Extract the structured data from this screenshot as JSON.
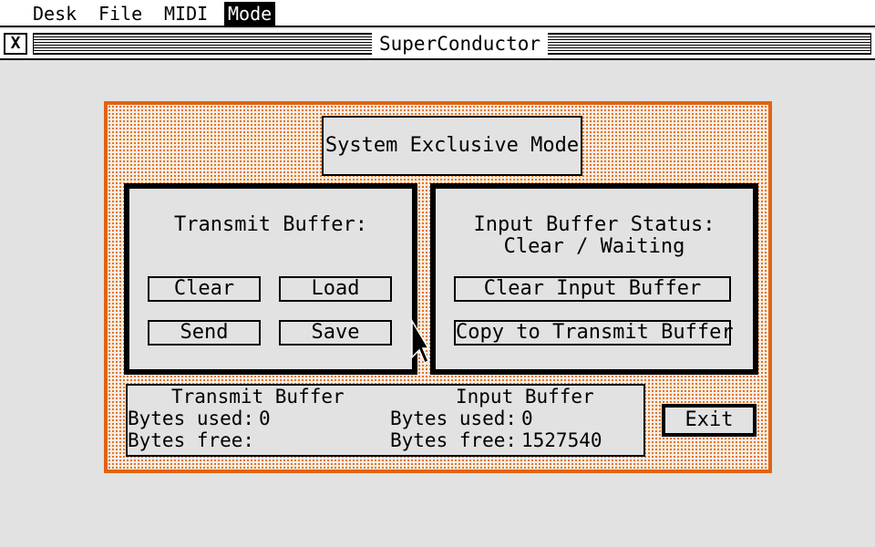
{
  "menubar": {
    "items": [
      "Desk",
      "File",
      "MIDI",
      "Mode"
    ],
    "active": "Mode"
  },
  "window": {
    "title": "SuperConductor",
    "close_glyph": "X"
  },
  "dialog": {
    "heading": "System Exclusive Mode",
    "transmit_panel": {
      "title": "Transmit Buffer:",
      "buttons": {
        "clear": "Clear",
        "load": "Load",
        "send": "Send",
        "save": "Save"
      }
    },
    "input_panel": {
      "title_line1": "Input Buffer Status:",
      "title_line2": "Clear / Waiting",
      "buttons": {
        "clear_input": "Clear Input Buffer",
        "copy_to_transmit": "Copy to Transmit Buffer"
      }
    },
    "status": {
      "transmit": {
        "header": "Transmit Buffer",
        "bytes_used_label": "Bytes used:",
        "bytes_used_value": "0",
        "bytes_free_label": "Bytes free:",
        "bytes_free_value": ""
      },
      "input": {
        "header": "Input Buffer",
        "bytes_used_label": "Bytes used:",
        "bytes_used_value": "0",
        "bytes_free_label": "Bytes free:",
        "bytes_free_value": "1527540"
      }
    },
    "exit_label": "Exit"
  },
  "colors": {
    "dialog_border": "#e0640f",
    "dialog_pattern": "#e8751a",
    "background": "#e2e2e2"
  }
}
